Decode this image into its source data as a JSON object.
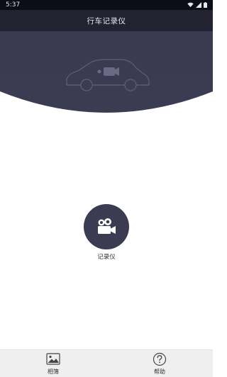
{
  "status_bar": {
    "time": "5:37",
    "icons": [
      "wifi-icon",
      "signal-icon",
      "battery-icon"
    ]
  },
  "header": {
    "title": "行车记录仪"
  },
  "main": {
    "record_button": {
      "icon": "video-camera-icon",
      "label": "记录仪"
    }
  },
  "bottom_nav": {
    "items": [
      {
        "icon": "image-icon",
        "label": "相簿"
      },
      {
        "icon": "help-icon",
        "label": "帮助"
      }
    ]
  },
  "colors": {
    "header_bg": "#3b3b52",
    "status_bar_bg": "#0b0e16",
    "accent": "#3b3b52",
    "nav_bg": "#efefef"
  }
}
